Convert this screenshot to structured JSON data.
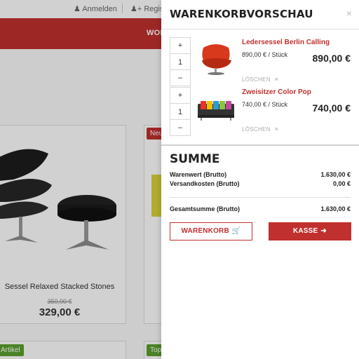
{
  "background": {
    "topbar": {
      "login": "Anmelden",
      "register": "Registr"
    },
    "nav": {
      "label": "WOH"
    },
    "products": [
      {
        "name": "Sessel Relaxed Stacked Stones",
        "old_price": "350,00 €",
        "price": "329,00 €"
      }
    ],
    "badges": {
      "new": "Neu",
      "article": "Artikel",
      "top": "Top"
    }
  },
  "cart_panel": {
    "title": "WARENKORBVORSCHAU",
    "close_icon": "×",
    "items": [
      {
        "name": "Ledersessel Berlin Calling",
        "unit_price": "890,00 € / Stück",
        "total": "890,00 €",
        "quantity": "1",
        "plus": "+",
        "minus": "–",
        "delete_label": "LÖSCHEN",
        "delete_icon": "×"
      },
      {
        "name": "Zweisitzer Color Pop",
        "unit_price": "740,00 € / Stück",
        "total": "740,00 €",
        "quantity": "1",
        "plus": "+",
        "minus": "–",
        "delete_label": "LÖSCHEN",
        "delete_icon": "×"
      }
    ],
    "summary": {
      "title": "SUMME",
      "rows": [
        {
          "label": "Warenwert (Brutto)",
          "value": "1.630,00 €"
        },
        {
          "label": "Versandkosten (Brutto)",
          "value": "0,00 €"
        }
      ],
      "total": {
        "label": "Gesamtsumme (Brutto)",
        "value": "1.630,00 €"
      }
    },
    "buttons": {
      "cart": "WARENKORB",
      "checkout": "KASSE"
    }
  },
  "colors": {
    "accent": "#c0302e",
    "badge_new": "#c0302e",
    "badge_green": "#5aa02c"
  }
}
